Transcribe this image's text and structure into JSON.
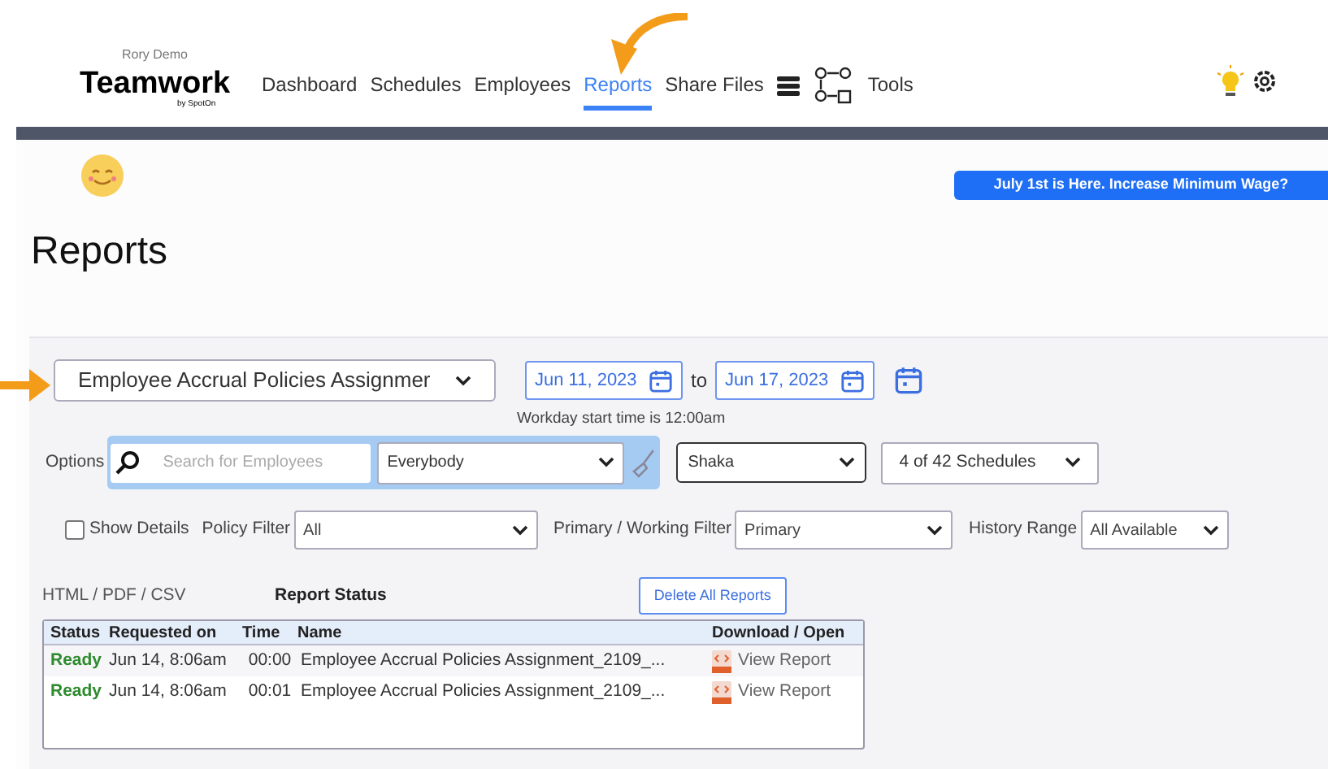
{
  "header": {
    "account": "Rory Demo",
    "logo": "Teamwork",
    "logo_sub": "by SpotOn",
    "nav": [
      {
        "label": "Dashboard",
        "selected": false,
        "kind": "text"
      },
      {
        "label": "Schedules",
        "selected": false,
        "kind": "text"
      },
      {
        "label": "Employees",
        "selected": false,
        "kind": "text"
      },
      {
        "label": "Reports",
        "selected": true,
        "kind": "text"
      },
      {
        "label": "Share Files",
        "selected": false,
        "kind": "text"
      },
      {
        "kind": "stack"
      },
      {
        "kind": "flow"
      },
      {
        "label": "Tools",
        "selected": false,
        "kind": "text"
      }
    ]
  },
  "banner": "July 1st is Here. Increase Minimum Wage?",
  "title": "Reports",
  "report_select": "Employee Accrual Policies Assignmer",
  "date_from": "Jun 11, 2023",
  "date_sep": "to",
  "date_to": "Jun 17, 2023",
  "workday_note": "Workday start time is 12:00am",
  "options": {
    "label": "Options",
    "search_placeholder": "Search for Employees",
    "group": "Everybody",
    "location": "Shaka",
    "schedules": "4 of 42 Schedules"
  },
  "filters": {
    "show_details": {
      "label": "Show Details",
      "checked": false
    },
    "policy_label": "Policy Filter",
    "policy": "All",
    "primary_label": "Primary / Working Filter",
    "primary": "Primary",
    "history_label": "History Range",
    "history": "All Available"
  },
  "formats": "HTML / PDF / CSV",
  "status_title": "Report Status",
  "delete_button": "Delete All Reports",
  "table": {
    "columns": [
      "Status",
      "Requested on",
      "Time",
      "Name",
      "Download / Open"
    ],
    "rows": [
      {
        "status": "Ready",
        "requested": "Jun 14, 8:06am",
        "time": "00:00",
        "name": "Employee Accrual Policies Assignment_2109_...",
        "link": "View Report"
      },
      {
        "status": "Ready",
        "requested": "Jun 14, 8:06am",
        "time": "00:01",
        "name": "Employee Accrual Policies Assignment_2109_...",
        "link": "View Report"
      }
    ]
  }
}
